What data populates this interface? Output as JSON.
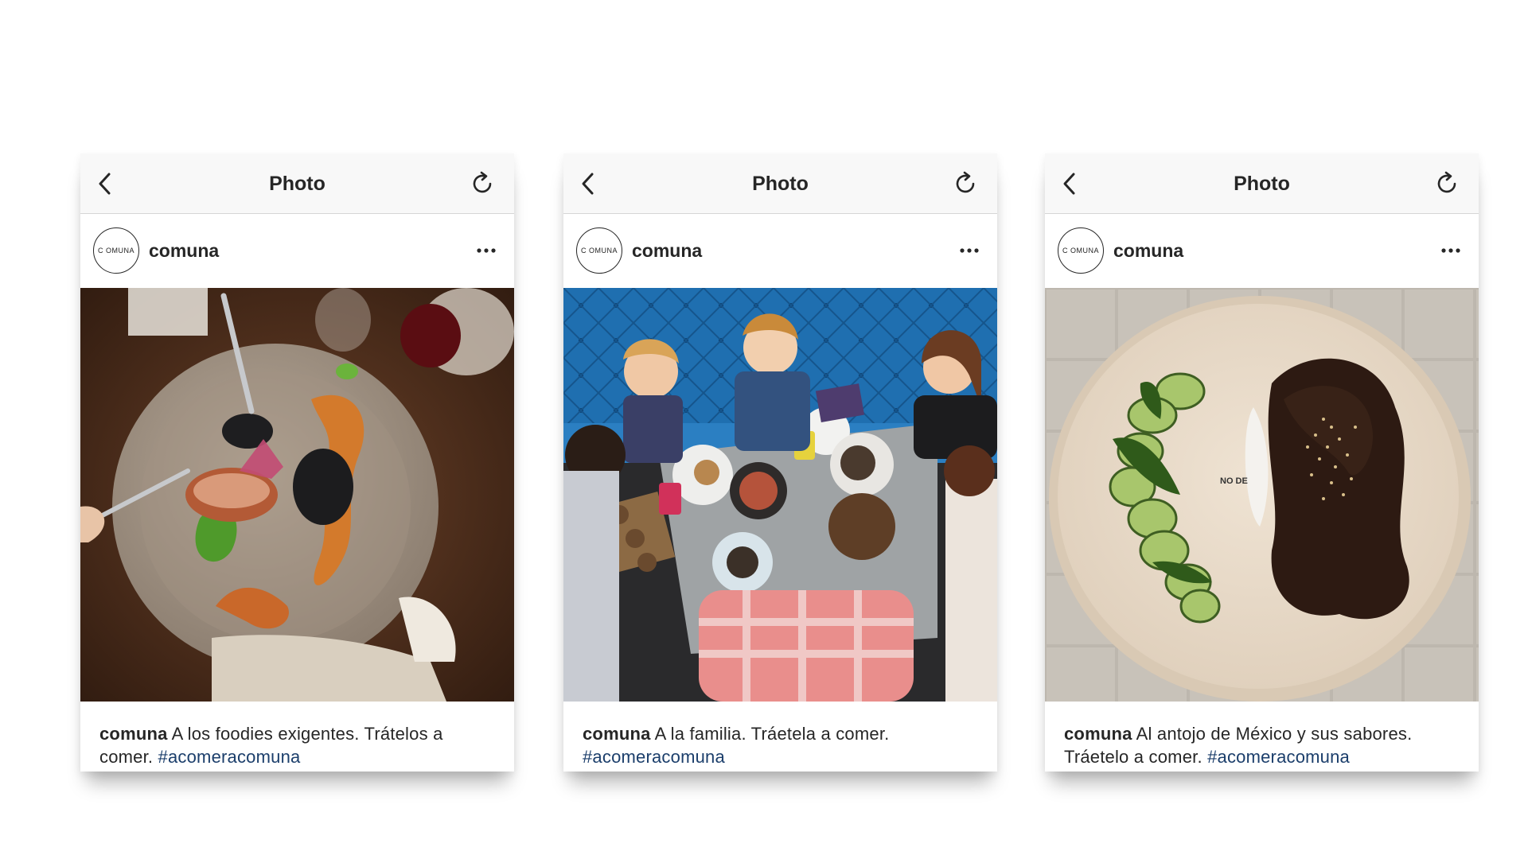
{
  "posts": [
    {
      "topbar_title": "Photo",
      "avatar_text": "C OMUNA",
      "username": "comuna",
      "caption_user": "comuna",
      "caption_text": " A los foodies exigentes. Trátelos a comer. ",
      "hashtag": "#acomeracomuna"
    },
    {
      "topbar_title": "Photo",
      "avatar_text": "C OMUNA",
      "username": "comuna",
      "caption_user": "comuna",
      "caption_text": " A la familia. Tráetela a comer. ",
      "hashtag": "#acomeracomuna"
    },
    {
      "topbar_title": "Photo",
      "avatar_text": "C OMUNA",
      "username": "comuna",
      "caption_user": "comuna",
      "caption_text": " Al antojo de México y sus sabores. Tráetelo a comer. ",
      "hashtag": "#acomeracomuna"
    }
  ],
  "photo3_plate_text": "NO DE",
  "icons": {
    "back": "chevron-left-icon",
    "refresh": "refresh-icon",
    "more": "more-horizontal-icon"
  },
  "colors": {
    "topbar_bg": "#f8f8f8",
    "text": "#262626",
    "hashtag": "#1b3e6b"
  }
}
